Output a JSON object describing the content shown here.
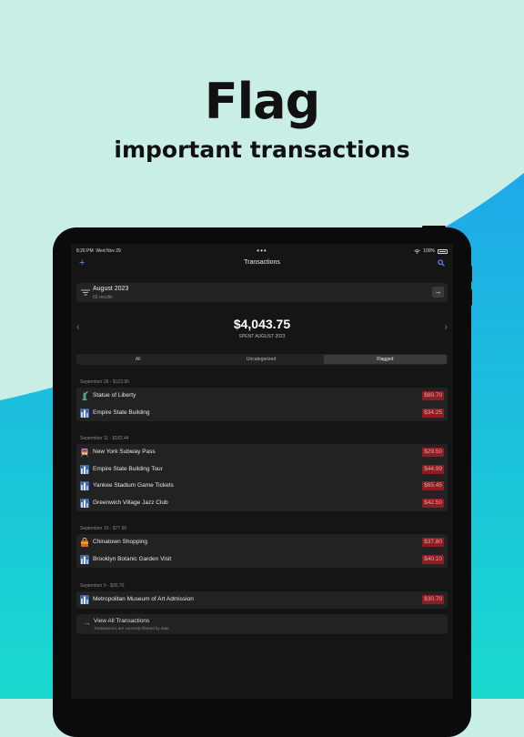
{
  "hero": {
    "title": "Flag",
    "subtitle": "important transactions"
  },
  "colors": {
    "accent": "#5b8dff",
    "amount_bg": "#8b1e25",
    "amount_text": "#f0a0a0",
    "bg_mint": "#c8eee6",
    "bg_blue": "#1fb6e3"
  },
  "status_bar": {
    "time": "8:26 PM",
    "date": "Wed Nov 29",
    "battery": "100%"
  },
  "nav": {
    "title": "Transactions",
    "add_icon": "plus-icon",
    "search_icon": "search-icon"
  },
  "filter": {
    "title": "August 2023",
    "count": "66 results",
    "icon": "filter-icon",
    "arrow_icon": "arrow-right-icon"
  },
  "summary": {
    "total": "$4,043.75",
    "label": "SPENT AUGUST 2023"
  },
  "tabs": [
    {
      "label": "All",
      "active": false
    },
    {
      "label": "Uncategorized",
      "active": false
    },
    {
      "label": "Flagged",
      "active": true
    }
  ],
  "sections": [
    {
      "header": "September 28 - $123.95",
      "items": [
        {
          "name": "Statue of Liberty",
          "amount": "$89.70",
          "icon": "statue-icon"
        },
        {
          "name": "Empire State Building",
          "amount": "$34.25",
          "icon": "city-icon"
        }
      ]
    },
    {
      "header": "September 11 - $182.44",
      "items": [
        {
          "name": "New York Subway Pass",
          "amount": "$29.50",
          "icon": "subway-icon"
        },
        {
          "name": "Empire State Building Tour",
          "amount": "$44.99",
          "icon": "city-icon"
        },
        {
          "name": "Yankee Stadium Game Tickets",
          "amount": "$65.45",
          "icon": "city-icon"
        },
        {
          "name": "Greenwich Village Jazz Club",
          "amount": "$42.50",
          "icon": "city-icon"
        }
      ]
    },
    {
      "header": "September 10 - $77.90",
      "items": [
        {
          "name": "Chinatown Shopping",
          "amount": "$37.80",
          "icon": "shopping-icon"
        },
        {
          "name": "Brooklyn Botanic Garden Visit",
          "amount": "$40.10",
          "icon": "city-icon"
        }
      ]
    },
    {
      "header": "September 9 - $30.70",
      "items": [
        {
          "name": "Metropolitan Museum of Art Admission",
          "amount": "$30.70",
          "icon": "city-icon"
        }
      ]
    }
  ],
  "view_all": {
    "title": "View All Transactions",
    "subtitle": "Transactions are currently filtered by date"
  }
}
